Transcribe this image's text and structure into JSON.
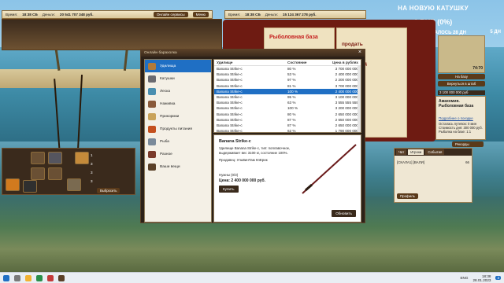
{
  "top_left_bar": {
    "time_label": "Время:",
    "time": "18:38 СБ",
    "money_label": "Деньги:",
    "money": "20 541 707 348 руб.",
    "online_btn": "Онлайн сервисы",
    "menu_btn": "Меню"
  },
  "top_mid_bar": {
    "time_label": "Время:",
    "time": "18:38 СБ",
    "money_label": "Деньги:",
    "money": "15 124 367 278 руб.",
    "online_btn": "Онлайн сервисы"
  },
  "promo": {
    "headline": "НА НОВУЮ КАТУШКУ",
    "amount": "0 RUB (0%)",
    "remaining": "ОСТАЛОСЬ 28 ДН",
    "extra": "5 ДН"
  },
  "shop": {
    "title": "Рыболовная база",
    "menu": [
      "продать",
      "купить",
      "ъявлений",
      "ныри",
      "ры",
      "мады"
    ]
  },
  "dialog": {
    "title": "Онлайн барахолка",
    "categories": [
      {
        "label": "Удилища",
        "selected": true
      },
      {
        "label": "Катушки"
      },
      {
        "label": "Леска"
      },
      {
        "label": "Наживка"
      },
      {
        "label": "Прикормки"
      },
      {
        "label": "Продукты питания"
      },
      {
        "label": "Рыба"
      },
      {
        "label": "Разное"
      },
      {
        "label": "Ваши вещи"
      }
    ],
    "table": {
      "headers": [
        "Удилище",
        "Состояние",
        "Цена в рублях"
      ],
      "rows": [
        [
          "Banana Strike-c",
          "80 %",
          "3 700 000 000"
        ],
        [
          "Banana Strike-c",
          "53 %",
          "2 400 000 000"
        ],
        [
          "Banana Strike-c",
          "97 %",
          "2 200 000 000"
        ],
        [
          "Banana Strike-c",
          "81 %",
          "3 700 000 000"
        ],
        [
          "Banana Strike-c",
          "100 %",
          "2 400 000 000"
        ],
        [
          "Banana Strike-c",
          "95 %",
          "3 100 000 000"
        ],
        [
          "Banana Strike-c",
          "63 %",
          "3 555 555 555"
        ],
        [
          "Banana Strike-c",
          "100 %",
          "3 200 000 000"
        ],
        [
          "Banana Strike-c",
          "80 %",
          "2 650 000 000"
        ],
        [
          "Banana Strike-c",
          "87 %",
          "2 650 000 000"
        ],
        [
          "Banana Strike-c",
          "87 %",
          "2 650 000 000"
        ],
        [
          "Banana Strike-c",
          "62 %",
          "1 790 000 000"
        ],
        [
          "Banana Strike-c",
          "100 %",
          "3 400 000 000"
        ],
        [
          "Banana Strike-c",
          "85 %",
          "2 300 000 000"
        ]
      ],
      "selected_index": 4
    },
    "detail": {
      "name": "Banana Strike-c",
      "desc": "Удилище Banana Strike-c, тип: поплавочное, выдерживает вес 3100 кг, состояние 100%.",
      "seller": "Продавец: УльВинТам КпЕрик",
      "likes": "Нужны (0/3)",
      "price": "Цена: 2 400 000 000 руб.",
      "buy_btn": "Купить",
      "refresh_btn": "Обновить"
    }
  },
  "right_panel": {
    "coords": "74:70",
    "btn1": "На базу",
    "btn2": "Вернуться в штаб",
    "money": "3 100 000 000 руб",
    "info_title": "Амахомия. Рыболовная база",
    "info_link": "Подробнее о поездке",
    "info_text": "Осталась путевок: 0 мин\nСтоимость дня: 300 000 руб.\nРыбалка на базе: 1:1",
    "records_btn": "Рекорды"
  },
  "chat": {
    "tabs": [
      "Чат",
      "Игроки",
      "События"
    ],
    "line_name": "[СКАЛА1] [ВАЛИ]",
    "line_value": "66",
    "button": "Профиль"
  },
  "inventory": {
    "stats": [
      "1",
      "3",
      "3",
      "3"
    ],
    "sell_btn": "Выбросить"
  },
  "taskbar": {
    "lang": "ENG",
    "time": "18:38",
    "date": "28.01.2023",
    "badge": "3"
  }
}
